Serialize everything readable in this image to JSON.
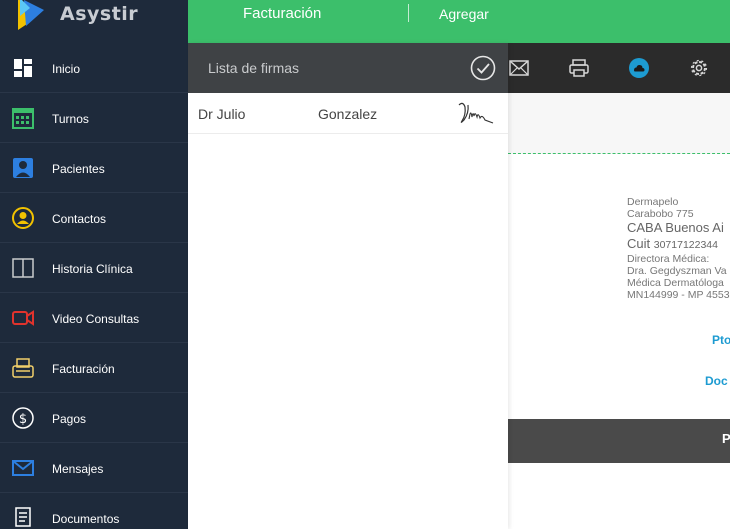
{
  "app": {
    "name": "Asystir"
  },
  "sidebar": {
    "items": [
      {
        "label": "Inicio",
        "icon": "dashboard-icon"
      },
      {
        "label": "Turnos",
        "icon": "calendar-icon"
      },
      {
        "label": "Pacientes",
        "icon": "patient-icon"
      },
      {
        "label": "Contactos",
        "icon": "contacts-icon"
      },
      {
        "label": "Historia Clínica",
        "icon": "book-icon"
      },
      {
        "label": "Video Consultas",
        "icon": "video-camera-icon"
      },
      {
        "label": "Facturación",
        "icon": "billing-icon"
      },
      {
        "label": "Pagos",
        "icon": "dollar-icon"
      },
      {
        "label": "Mensajes",
        "icon": "envelope-icon"
      },
      {
        "label": "Documentos",
        "icon": "documents-icon"
      }
    ]
  },
  "topbar": {
    "title": "Facturación",
    "add_label": "Agregar"
  },
  "toolbar": {
    "icons": [
      "mail-icon",
      "print-icon",
      "cloud-icon",
      "gear-icon"
    ],
    "cloud_color": "#1d9bd1"
  },
  "panel": {
    "title": "Lista de firmas",
    "signatures": [
      {
        "first_name": "Dr Julio",
        "last_name": "Gonzalez"
      }
    ]
  },
  "document": {
    "clinic": "Dermapelo",
    "street": "Carabobo 775",
    "city": "CABA Buenos Ai",
    "cuit_label": "Cuit",
    "cuit_value": "30717122344",
    "director_title": "Directora Médica:",
    "director_name": "Dra. Gegdyszman Va",
    "director_specialty": "Médica Dermatóloga",
    "director_license": "MN144999 - MP 4553",
    "link1": "Pto",
    "link2": "Doc",
    "bar_text": "P"
  },
  "colors": {
    "accent": "#3cbf6b",
    "sidebar_bg": "#1e2a3b",
    "link": "#1d9bd1"
  }
}
